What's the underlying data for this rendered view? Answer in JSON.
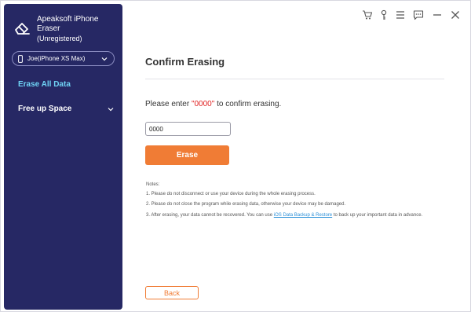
{
  "app": {
    "name": "Apeaksoft iPhone Eraser",
    "status": "(Unregistered)",
    "logo_icon": "eraser-icon"
  },
  "device": {
    "label": "Joe(iPhone XS Max)",
    "icon": "phone-icon"
  },
  "sidebar": {
    "items": [
      {
        "label": "Erase All Data",
        "active": true
      },
      {
        "label": "Free up Space",
        "expandable": true
      }
    ]
  },
  "toolbar": {
    "icons": [
      "cart-icon",
      "key-icon",
      "menu-icon",
      "feedback-icon",
      "minimize-icon",
      "close-icon"
    ]
  },
  "main": {
    "title": "Confirm Erasing",
    "prompt_prefix": "Please enter ",
    "prompt_code": "\"0000\"",
    "prompt_suffix": " to confirm erasing.",
    "input_value": "0000",
    "erase_label": "Erase",
    "notes_title": "Notes:",
    "notes": [
      "1. Please do not disconnect or use your device during the whole erasing process.",
      "2. Please do not close the program while erasing data, otherwise your device may be damaged."
    ],
    "note3_prefix": "3. After erasing, your data cannot be recovered. You can use ",
    "note3_link": "iOS Data Backup & Restore",
    "note3_suffix": " to back up your important data in advance.",
    "back_label": "Back"
  },
  "colors": {
    "sidebar_bg": "#262864",
    "accent_orange": "#f07c35",
    "active_nav": "#6fd3f5",
    "code_red": "#e02020",
    "link_blue": "#2a8fd8"
  }
}
